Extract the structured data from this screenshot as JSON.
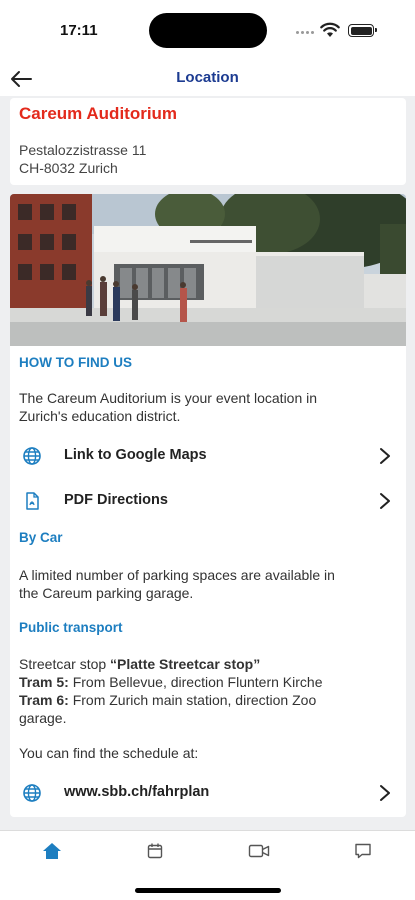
{
  "status_bar": {
    "time": "17:11"
  },
  "header": {
    "title": "Location"
  },
  "venue": {
    "name": "Careum Auditorium",
    "address_line1": "Pestalozzistrasse 11",
    "address_line2": "CH-8032 Zurich"
  },
  "how_to_find": {
    "heading": "HOW TO FIND US",
    "intro_line1": "The Careum Auditorium is your event location in",
    "intro_line2": "Zurich's education district."
  },
  "links": {
    "google_maps": "Link to Google Maps",
    "pdf_directions": "PDF Directions",
    "sbb": "www.sbb.ch/fahrplan"
  },
  "by_car": {
    "heading": "By Car",
    "line1": "A limited number of parking spaces are available in",
    "line2": "the Careum parking garage."
  },
  "public_transport": {
    "heading": "Public transport",
    "stop_prefix": "Streetcar stop ",
    "stop_name": "“Platte Streetcar stop”",
    "tram5_label": "Tram 5:",
    "tram5_text": " From Bellevue, direction Fluntern Kirche",
    "tram6_label": "Tram 6:",
    "tram6_text": " From Zurich main station, direction Zoo",
    "tram6_cont": "garage.",
    "schedule_text": "You can find the schedule at:"
  },
  "tabs": {
    "active": "home",
    "items": [
      "home-icon",
      "calendar-icon",
      "video-icon",
      "chat-icon"
    ]
  },
  "colors": {
    "venue_name": "#e32a1c",
    "section_heading": "#1d7ec0",
    "nav_title": "#1c3b91",
    "active_tab": "#1d7ec0"
  }
}
